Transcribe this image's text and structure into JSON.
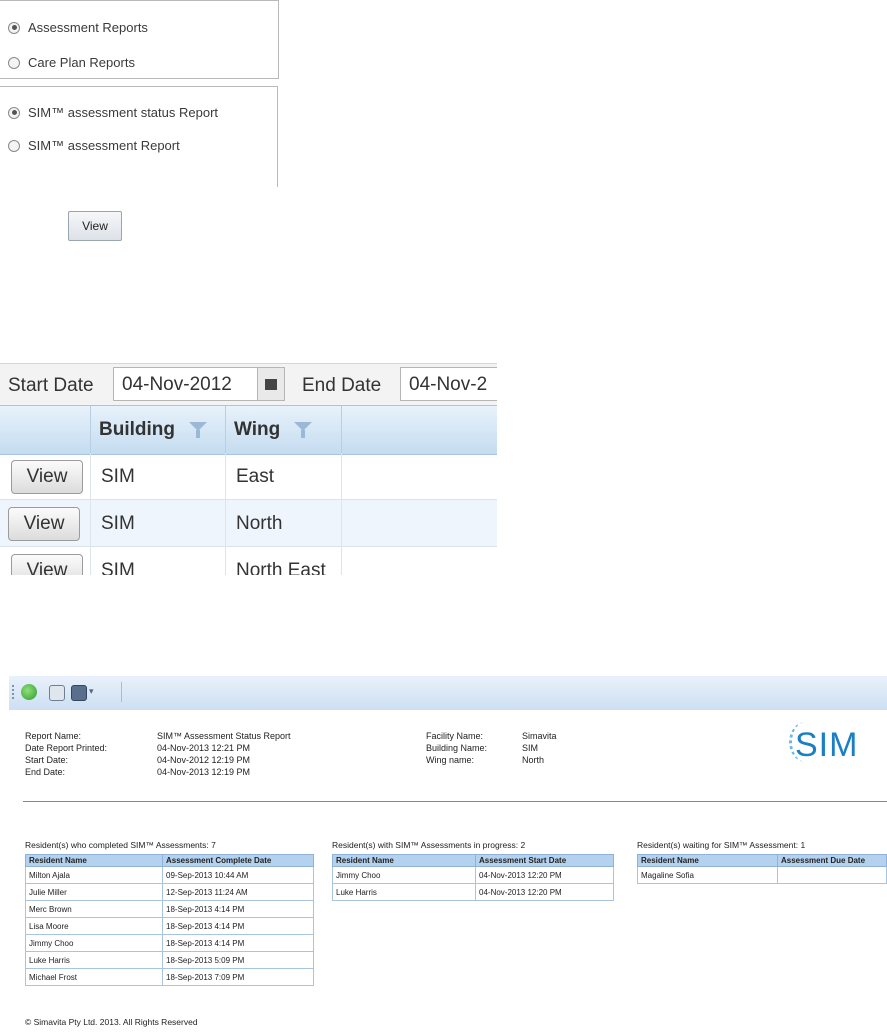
{
  "report_category": {
    "options": [
      {
        "label": "Assessment Reports",
        "selected": true
      },
      {
        "label": "Care Plan Reports",
        "selected": false
      }
    ]
  },
  "report_type": {
    "options": [
      {
        "label": "SIM™ assessment status Report",
        "selected": true
      },
      {
        "label": "SIM™ assessment Report",
        "selected": false
      }
    ]
  },
  "view_button_label": "View",
  "grid": {
    "start_label": "Start Date",
    "start_value": "04-Nov-2012",
    "end_label": "End Date",
    "end_value": "04-Nov-2",
    "columns": [
      "Building",
      "Wing"
    ],
    "rows": [
      {
        "button": "View",
        "building": "SIM",
        "wing": "East"
      },
      {
        "button": "View",
        "building": "SIM",
        "wing": "North"
      },
      {
        "button": "View",
        "building": "SIM",
        "wing": "North East"
      }
    ]
  },
  "report": {
    "header_left_labels": [
      "Report Name:",
      "Date Report Printed:",
      "Start Date:",
      "End Date:"
    ],
    "header_left_values": [
      "SIM™ Assessment Status Report",
      "04-Nov-2013 12:21 PM",
      "04-Nov-2012 12:19 PM",
      "04-Nov-2013 12:19 PM"
    ],
    "header_right_labels": [
      "Facility Name:",
      "Building Name:",
      "Wing name:"
    ],
    "header_right_values": [
      "Simavita",
      "SIM",
      "North"
    ],
    "logo_text": "SIM",
    "completed": {
      "title": "Resident(s) who completed SIM™ Assessments: 7",
      "columns": [
        "Resident Name",
        "Assessment Complete Date"
      ],
      "rows": [
        [
          "Milton Ajala",
          "09-Sep-2013 10:44 AM"
        ],
        [
          "Julie Miller",
          "12-Sep-2013 11:24 AM"
        ],
        [
          "Merc Brown",
          "18-Sep-2013 4:14 PM"
        ],
        [
          "Lisa Moore",
          "18-Sep-2013 4:14 PM"
        ],
        [
          "Jimmy Choo",
          "18-Sep-2013 4:14 PM"
        ],
        [
          "Luke Harris",
          "18-Sep-2013 5:09 PM"
        ],
        [
          "Michael Frost",
          "18-Sep-2013 7:09 PM"
        ]
      ]
    },
    "in_progress": {
      "title": "Resident(s) with SIM™ Assessments in progress: 2",
      "columns": [
        "Resident Name",
        "Assessment Start Date"
      ],
      "rows": [
        [
          "Jimmy Choo",
          "04-Nov-2013 12:20 PM"
        ],
        [
          "Luke Harris",
          "04-Nov-2013 12:20 PM"
        ]
      ]
    },
    "waiting": {
      "title": "Resident(s) waiting for SIM™ Assessment: 1",
      "columns": [
        "Resident Name",
        "Assessment Due Date"
      ],
      "rows": [
        [
          "Magaline Sofia",
          ""
        ]
      ]
    },
    "copyright": "© Simavita Pty Ltd. 2013. All Rights Reserved"
  },
  "colors": {
    "grid_header": "#c4dcf0",
    "grid_alt_row": "#eef5fc",
    "table_header": "#b4d2f0",
    "logo": "#1a7fc4"
  }
}
